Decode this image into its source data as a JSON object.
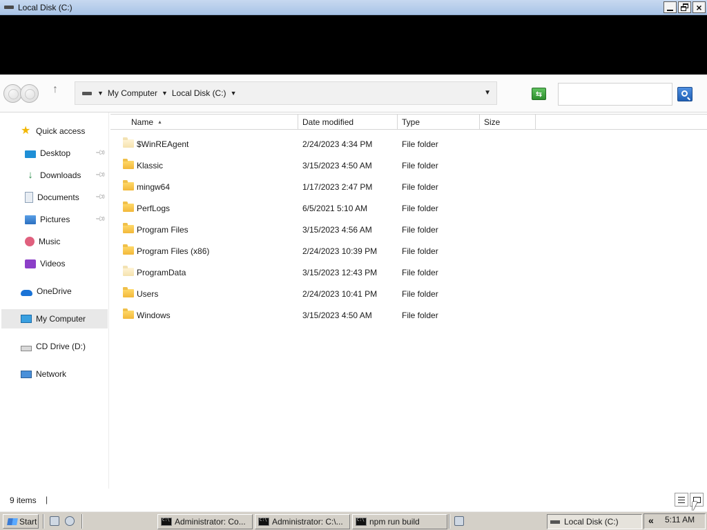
{
  "window": {
    "title": "Local Disk (C:)"
  },
  "toolbar": {
    "breadcrumbs": [
      "My Computer",
      "Local Disk (C:)"
    ],
    "search_placeholder": "",
    "search_value": ""
  },
  "sidebar": {
    "items": [
      {
        "label": "Quick access",
        "icon": "star-icon",
        "pinned": false
      },
      {
        "label": "Desktop",
        "icon": "desktop-icon",
        "pinned": true
      },
      {
        "label": "Downloads",
        "icon": "download-icon",
        "pinned": true
      },
      {
        "label": "Documents",
        "icon": "documents-icon",
        "pinned": true
      },
      {
        "label": "Pictures",
        "icon": "pictures-icon",
        "pinned": true
      },
      {
        "label": "Music",
        "icon": "music-icon",
        "pinned": false
      },
      {
        "label": "Videos",
        "icon": "videos-icon",
        "pinned": false
      },
      {
        "label": "OneDrive",
        "icon": "cloud-icon",
        "pinned": false
      },
      {
        "label": "My Computer",
        "icon": "computer-icon",
        "pinned": false,
        "selected": true
      },
      {
        "label": "CD Drive (D:)",
        "icon": "cd-drive-icon",
        "pinned": false
      },
      {
        "label": "Network",
        "icon": "network-icon",
        "pinned": false
      }
    ]
  },
  "columns": {
    "name": "Name",
    "date": "Date modified",
    "type": "Type",
    "size": "Size",
    "sorted_by": "Name",
    "sort_direction": "ascending"
  },
  "files": [
    {
      "name": "$WinREAgent",
      "date": "2/24/2023 4:34 PM",
      "type": "File folder",
      "hidden": true
    },
    {
      "name": "Klassic",
      "date": "3/15/2023 4:50 AM",
      "type": "File folder",
      "hidden": false
    },
    {
      "name": "mingw64",
      "date": "1/17/2023 2:47 PM",
      "type": "File folder",
      "hidden": false
    },
    {
      "name": "PerfLogs",
      "date": "6/5/2021 5:10 AM",
      "type": "File folder",
      "hidden": false
    },
    {
      "name": "Program Files",
      "date": "3/15/2023 4:56 AM",
      "type": "File folder",
      "hidden": false
    },
    {
      "name": "Program Files (x86)",
      "date": "2/24/2023 10:39 PM",
      "type": "File folder",
      "hidden": false
    },
    {
      "name": "ProgramData",
      "date": "3/15/2023 12:43 PM",
      "type": "File folder",
      "hidden": true
    },
    {
      "name": "Users",
      "date": "2/24/2023 10:41 PM",
      "type": "File folder",
      "hidden": false
    },
    {
      "name": "Windows",
      "date": "3/15/2023 4:50 AM",
      "type": "File folder",
      "hidden": false
    }
  ],
  "status": {
    "item_count": "9 items",
    "separator": "|"
  },
  "taskbar": {
    "start_label": "Start",
    "tasks": [
      {
        "label": "Administrator:  Co...",
        "icon": "cmd-icon"
      },
      {
        "label": "Administrator:  C:\\...",
        "icon": "cmd-icon"
      },
      {
        "label": "npm run build",
        "icon": "cmd-icon"
      },
      {
        "label": "Local Disk (C:)",
        "icon": "drive-icon",
        "active": true
      }
    ],
    "tray_chevron": "«",
    "clock": "5:11 AM"
  },
  "colors": {
    "titlebar": "#a9c4e6",
    "folder": "#f2b83a",
    "selection": "#e8e8e8",
    "taskbar": "#d4d0c8"
  }
}
